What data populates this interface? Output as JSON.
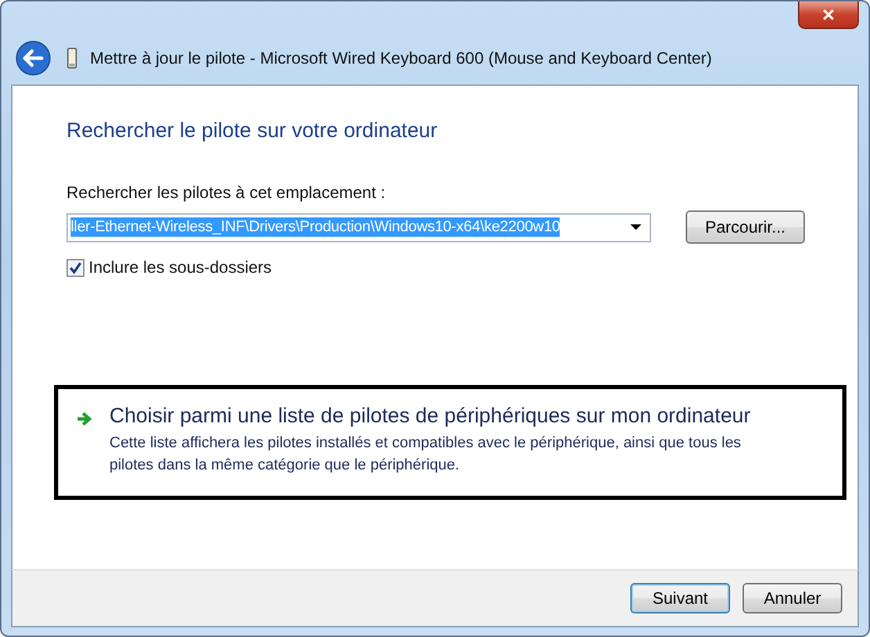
{
  "window": {
    "title": "Mettre à jour le pilote - Microsoft Wired Keyboard 600 (Mouse and Keyboard Center)",
    "close": "✕"
  },
  "heading": "Rechercher le pilote sur votre ordinateur",
  "location": {
    "label": "Rechercher les pilotes à cet emplacement :",
    "value": "ller-Ethernet-Wireless_INF\\Drivers\\Production\\Windows10-x64\\ke2200w10",
    "highlighted": true,
    "browse": "Parcourir..."
  },
  "subfolders": {
    "label": "Inclure les sous-dossiers",
    "checked": true
  },
  "option": {
    "title": "Choisir parmi une liste de pilotes de périphériques sur mon ordinateur",
    "description": "Cette liste affichera les pilotes installés et compatibles avec le périphérique, ainsi que tous les pilotes dans la même catégorie que le périphérique.",
    "focused": true
  },
  "buttons": [
    {
      "label": "Suivant",
      "default": true
    },
    {
      "label": "Annuler",
      "default": false
    }
  ]
}
